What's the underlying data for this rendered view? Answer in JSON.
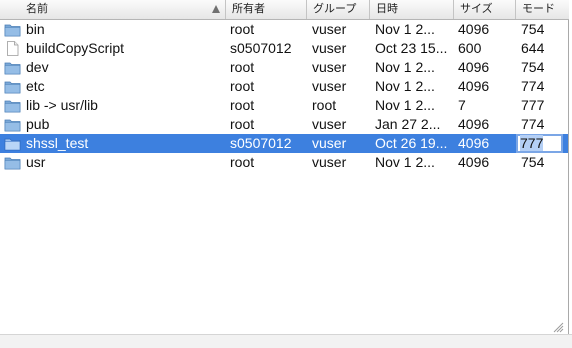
{
  "columns": {
    "name": "名前",
    "owner": "所有者",
    "group": "グループ",
    "date": "日時",
    "size": "サイズ",
    "mode": "モード"
  },
  "sort": {
    "column": "name",
    "direction": "ascending"
  },
  "files": [
    {
      "icon": "folder-icon",
      "name": "bin",
      "owner": "root",
      "group": "vuser",
      "date": "Nov  1  2...",
      "size": "4096",
      "mode": "754"
    },
    {
      "icon": "document-icon",
      "name": "buildCopyScript",
      "owner": "s0507012",
      "group": "vuser",
      "date": "Oct 23 15...",
      "size": "600",
      "mode": "644"
    },
    {
      "icon": "folder-icon",
      "name": "dev",
      "owner": "root",
      "group": "vuser",
      "date": "Nov  1  2...",
      "size": "4096",
      "mode": "754"
    },
    {
      "icon": "folder-icon",
      "name": "etc",
      "owner": "root",
      "group": "vuser",
      "date": "Nov  1  2...",
      "size": "4096",
      "mode": "774"
    },
    {
      "icon": "folder-icon",
      "name": "lib -> usr/lib",
      "owner": "root",
      "group": "root",
      "date": "Nov  1  2...",
      "size": "7",
      "mode": "777"
    },
    {
      "icon": "folder-icon",
      "name": "pub",
      "owner": "root",
      "group": "vuser",
      "date": "Jan 27  2...",
      "size": "4096",
      "mode": "774"
    },
    {
      "icon": "folder-icon",
      "name": "shssl_test",
      "owner": "s0507012",
      "group": "vuser",
      "date": "Oct 26 19...",
      "size": "4096",
      "mode": "777"
    },
    {
      "icon": "folder-icon",
      "name": "usr",
      "owner": "root",
      "group": "vuser",
      "date": "Nov  1  2...",
      "size": "4096",
      "mode": "754"
    }
  ],
  "selected_row": 6,
  "editing": {
    "row": 6,
    "field": "mode",
    "value": "777"
  },
  "colors": {
    "selection": "#3d80df",
    "folder": "#6f9fd0",
    "edit_border": "#7ba6e6"
  }
}
